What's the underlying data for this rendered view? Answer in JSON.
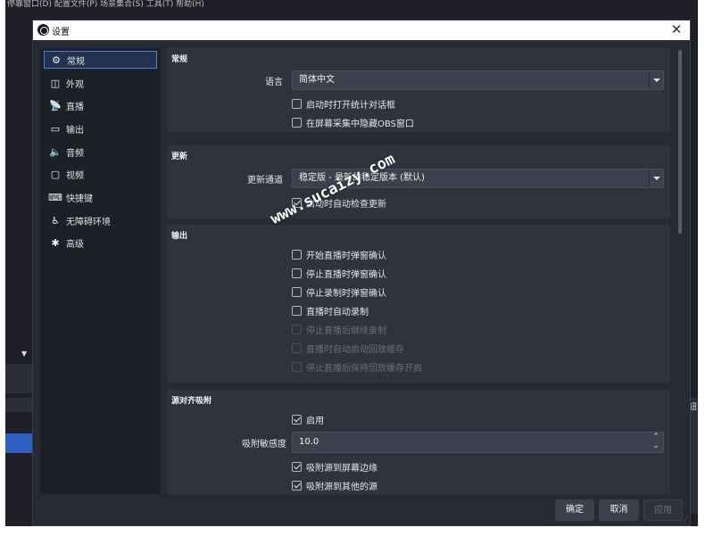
{
  "background": {
    "menubar_text": "停靠窗口(D)   配置文件(P)   场景集合(S)   工具(T)   帮助(H)",
    "right_edge_text": "钮"
  },
  "dialog": {
    "title": "设置",
    "close_glyph": "✕"
  },
  "sidebar": {
    "items": [
      {
        "label": "常规",
        "icon": "⚙"
      },
      {
        "label": "外观",
        "icon": "◫"
      },
      {
        "label": "直播",
        "icon": "📡"
      },
      {
        "label": "输出",
        "icon": "▭"
      },
      {
        "label": "音频",
        "icon": "🔈"
      },
      {
        "label": "视频",
        "icon": "▢"
      },
      {
        "label": "快捷键",
        "icon": "⌨"
      },
      {
        "label": "无障碍环境",
        "icon": "♿"
      },
      {
        "label": "高级",
        "icon": "✱"
      }
    ]
  },
  "general": {
    "title": "常规",
    "language_label": "语言",
    "language_value": "简体中文",
    "check_stats_dialog": "启动时打开统计对话框",
    "check_stats_dialog_on": false,
    "check_hide_obs": "在屏幕采集中隐藏OBS窗口",
    "check_hide_obs_on": false
  },
  "update": {
    "title": "更新",
    "channel_label": "更新通道",
    "channel_value": "稳定版 - 最新的稳定版本 (默认)",
    "check_auto_update": "启动时自动检查更新",
    "check_auto_update_on": true
  },
  "output": {
    "title": "输出",
    "items": [
      {
        "label": "开始直播时弹窗确认",
        "checked": false,
        "enabled": true
      },
      {
        "label": "停止直播时弹窗确认",
        "checked": false,
        "enabled": true
      },
      {
        "label": "停止录制时弹窗确认",
        "checked": false,
        "enabled": true
      },
      {
        "label": "直播时自动录制",
        "checked": false,
        "enabled": true
      },
      {
        "label": "停止直播后继续录制",
        "checked": false,
        "enabled": false
      },
      {
        "label": "直播时自动启动回放缓存",
        "checked": false,
        "enabled": false
      },
      {
        "label": "停止直播后保持回放缓存开启",
        "checked": false,
        "enabled": false
      }
    ]
  },
  "snapping": {
    "title": "源对齐吸附",
    "enable_label": "启用",
    "enable_on": true,
    "sensitivity_label": "吸附敏感度",
    "sensitivity_value": "10.0",
    "snap_screen_edge": "吸附源到屏幕边缘",
    "snap_screen_edge_on": true,
    "snap_other_sources": "吸附源到其他的源",
    "snap_other_sources_on": true
  },
  "footer": {
    "ok": "确定",
    "cancel": "取消",
    "apply": "应用"
  },
  "watermark": "www.sucaizy.com"
}
